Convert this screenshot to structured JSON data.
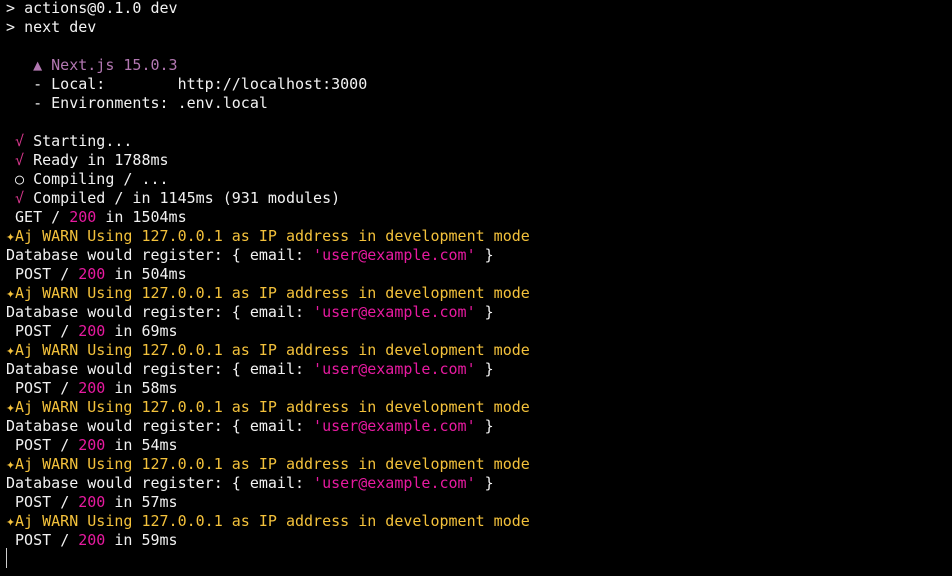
{
  "terminal": {
    "header": [
      {
        "prompt": "> ",
        "text": "actions@0.1.0 dev"
      },
      {
        "prompt": "> ",
        "text": "next dev"
      }
    ],
    "next": {
      "version_line": "▲ Next.js 15.0.3",
      "local_label": "- Local:        ",
      "local_url": "http://localhost:3000",
      "env_label": "- Environments: ",
      "env_value": ".env.local"
    },
    "steps": [
      {
        "icon": "√",
        "text": "Starting..."
      },
      {
        "icon": "√",
        "text": "Ready in 1788ms"
      },
      {
        "icon": "○",
        "text": "Compiling / ..."
      },
      {
        "icon": "√",
        "text": "Compiled / in 1145ms (931 modules)"
      }
    ],
    "get_request": {
      "method": "GET",
      "path": "/",
      "status": "200",
      "duration": "in 1504ms"
    },
    "warn_text": "✦Aj WARN Using 127.0.0.1 as IP address in development mode",
    "db_prefix": "Database would register: { email: ",
    "db_email": "'user@example.com'",
    "db_suffix": " }",
    "post_requests": [
      {
        "method": "POST",
        "path": "/",
        "status": "200",
        "duration": "in 504ms"
      },
      {
        "method": "POST",
        "path": "/",
        "status": "200",
        "duration": "in 69ms"
      },
      {
        "method": "POST",
        "path": "/",
        "status": "200",
        "duration": "in 58ms"
      },
      {
        "method": "POST",
        "path": "/",
        "status": "200",
        "duration": "in 54ms"
      },
      {
        "method": "POST",
        "path": "/",
        "status": "200",
        "duration": "in 57ms"
      },
      {
        "method": "POST",
        "path": "/",
        "status": "200",
        "duration": "in 59ms"
      }
    ],
    "colors": {
      "background": "#000000",
      "text": "#f2f2f2",
      "check": "#d5368b",
      "version": "#b277b1",
      "warn": "#f3c13b",
      "status": "#e71aa0"
    }
  }
}
